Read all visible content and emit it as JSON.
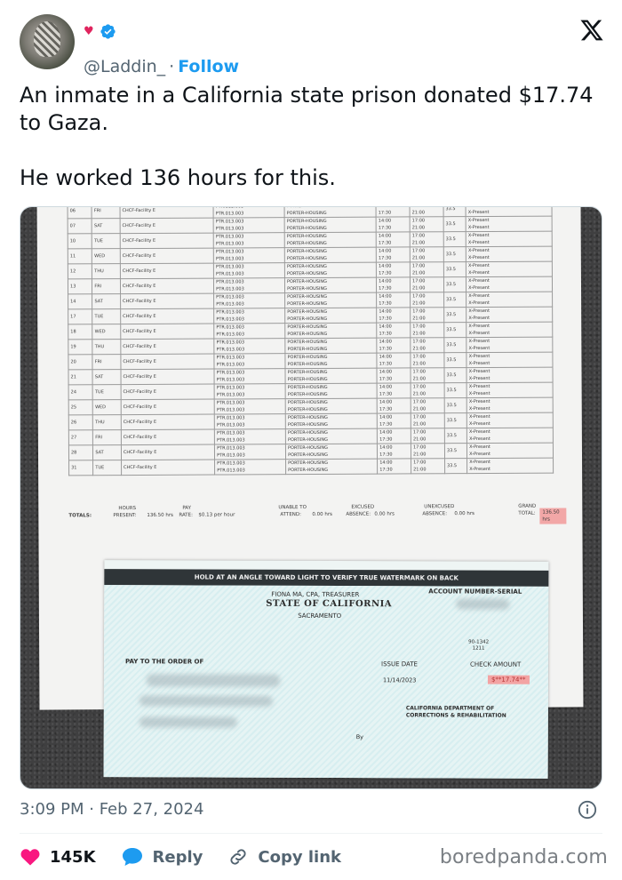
{
  "header": {
    "display_mark": "♥",
    "handle": "@Laddin_",
    "separator": "·",
    "follow_label": "Follow",
    "brand_icon": "x-logo-icon"
  },
  "tweet": {
    "paragraphs": [
      "An inmate in a California state prison donated $17.74 to Gaza.",
      "He worked 136 hours for this."
    ]
  },
  "image": {
    "timesheet_rows": [
      {
        "d": "06",
        "w": "FRI"
      },
      {
        "d": "07",
        "w": "SAT"
      },
      {
        "d": "10",
        "w": "TUE"
      },
      {
        "d": "11",
        "w": "WED"
      },
      {
        "d": "12",
        "w": "THU"
      },
      {
        "d": "13",
        "w": "FRI"
      },
      {
        "d": "14",
        "w": "SAT"
      },
      {
        "d": "17",
        "w": "TUE"
      },
      {
        "d": "18",
        "w": "WED"
      },
      {
        "d": "19",
        "w": "THU"
      },
      {
        "d": "20",
        "w": "FRI"
      },
      {
        "d": "21",
        "w": "SAT"
      },
      {
        "d": "24",
        "w": "TUE"
      },
      {
        "d": "25",
        "w": "WED"
      },
      {
        "d": "26",
        "w": "THU"
      },
      {
        "d": "27",
        "w": "FRI"
      },
      {
        "d": "28",
        "w": "SAT"
      },
      {
        "d": "31",
        "w": "TUE"
      }
    ],
    "row_constants": {
      "facility": "CHCF-Facility E",
      "code": "PTR.013.003",
      "job": "PORTER-HOUSING",
      "start_1": "14:00",
      "start_2": "17:30",
      "end_1": "17:00",
      "end_2": "21:00",
      "hrs_1": "3",
      "hrs_2": "3.5",
      "status": "X-Present"
    },
    "totals": {
      "label": "TOTALS:",
      "hours_present_label_1": "HOURS",
      "hours_present_label_2": "PRESENT:",
      "hours_present_value": "136.50 hrs",
      "pay_label_1": "PAY",
      "pay_label_2": "RATE:",
      "pay_value": "$0.13 per hour",
      "unable_label_1": "UNABLE TO",
      "unable_label_2": "ATTEND:",
      "unable_value": "0.00 hrs",
      "excused_label_1": "EXCUSED",
      "excused_label_2": "ABSENCE:",
      "excused_value": "0.00 hrs",
      "unexcused_label_1": "UNEXCUSED",
      "unexcused_label_2": "ABSENCE:",
      "unexcused_value": "0.00 hrs",
      "grand_label_1": "GRAND",
      "grand_label_2": "TOTAL:",
      "grand_value": "136.50 hrs"
    },
    "check": {
      "watermark_strip": "HOLD AT AN ANGLE TOWARD LIGHT TO VERIFY TRUE WATERMARK ON BACK",
      "account_label": "ACCOUNT NUMBER-SERIAL",
      "treasurer": "FIONA MA, CPA, TREASURER",
      "state": "STATE OF CALIFORNIA",
      "city": "SACRAMENTO",
      "routing_1": "90-1342",
      "routing_2": "1211",
      "pay_to_label": "PAY TO THE ORDER OF",
      "issue_date_label": "ISSUE DATE",
      "issue_date_value": "11/14/2023",
      "check_amount_label": "CHECK AMOUNT",
      "check_amount_value": "$**17.74**",
      "department_1": "CALIFORNIA DEPARTMENT OF",
      "department_2": "CORRECTIONS & REHABILITATION",
      "signature_label": "By"
    }
  },
  "footer": {
    "timestamp": "3:09 PM · Feb 27, 2024",
    "likes_count": "145K",
    "reply_label": "Reply",
    "copy_link_label": "Copy link",
    "source_watermark": "boredpanda.com"
  },
  "colors": {
    "accent": "#1d9bf0",
    "like": "#f91880",
    "text": "#0f1419",
    "muted": "#536471"
  }
}
